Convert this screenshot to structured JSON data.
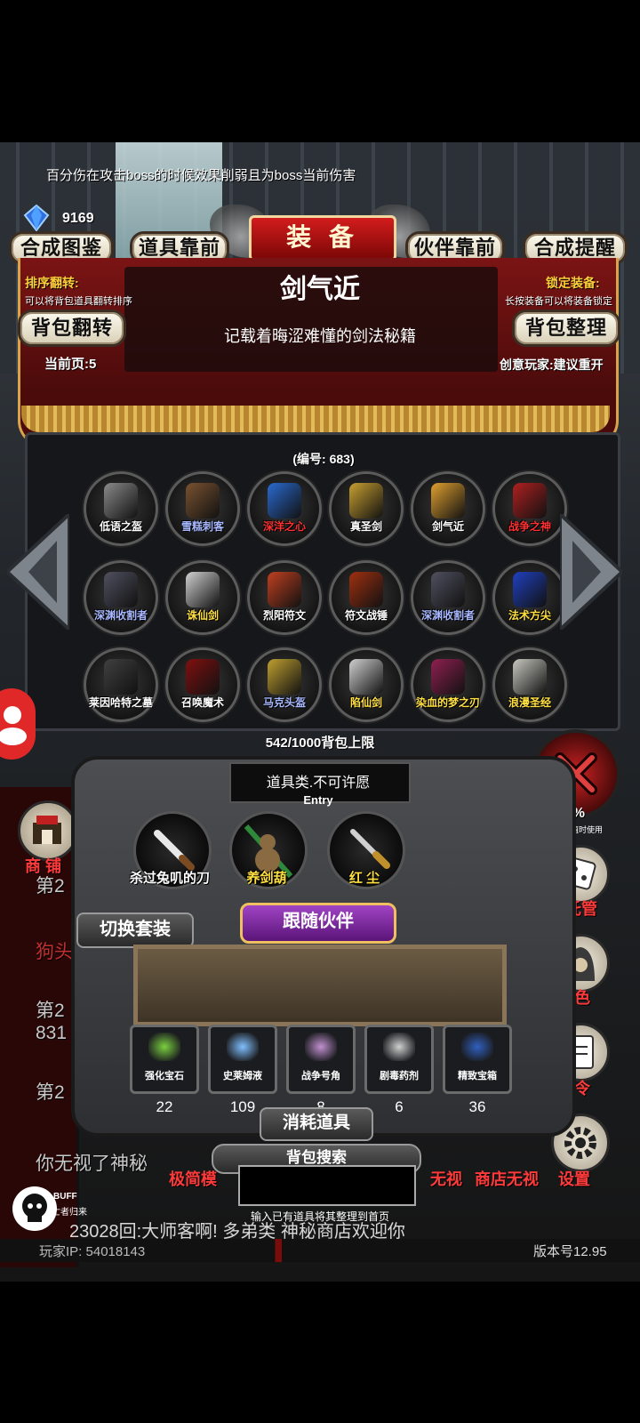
{
  "top_notice": "百分伤在攻击boss的时候效果削弱且为boss当前伤害",
  "gems": "9169",
  "header": {
    "btn_collection": "合成图鉴",
    "btn_items_front": "道具靠前",
    "title": "装 备",
    "btn_partner_front": "伙伴靠前",
    "btn_craft_remind": "合成提醒"
  },
  "sort": {
    "label": "排序翻转:",
    "note": "可以将背包道具翻转排序",
    "button": "背包翻转"
  },
  "lock": {
    "label": "锁定装备:",
    "note": "长按装备可以将装备锁定",
    "button": "背包整理"
  },
  "selected": {
    "name": "剑气近",
    "description": "记载着晦涩难懂的剑法秘籍",
    "page": "当前页:5",
    "creator": "创意玩家:建议重开",
    "id": "(编号: 683)"
  },
  "grid": [
    {
      "label": "低语之盔",
      "color": "#ffffff",
      "icon": "#8a8a8a"
    },
    {
      "label": "雪糕刺客",
      "color": "#a8b8ff",
      "icon": "#7a5230"
    },
    {
      "label": "深洋之心",
      "color": "#ff3030",
      "icon": "#2a6ad0"
    },
    {
      "label": "真圣剑",
      "color": "#ffffff",
      "icon": "#c9a030"
    },
    {
      "label": "剑气近",
      "color": "#ffffff",
      "icon": "#e0a030"
    },
    {
      "label": "战争之神",
      "color": "#ff3030",
      "icon": "#b02020"
    },
    {
      "label": "深渊收割者",
      "color": "#a8b8ff",
      "icon": "#505060"
    },
    {
      "label": "诛仙剑",
      "color": "#ffe040",
      "icon": "#d0d0d0"
    },
    {
      "label": "烈阳符文",
      "color": "#ffffff",
      "icon": "#c04020"
    },
    {
      "label": "符文战锤",
      "color": "#ffffff",
      "icon": "#a03010"
    },
    {
      "label": "深渊收割者",
      "color": "#a8b8ff",
      "icon": "#505060"
    },
    {
      "label": "法术方尖",
      "color": "#ffe040",
      "icon": "#2040c0"
    },
    {
      "label": "莱因哈特之墓",
      "color": "#ffffff",
      "icon": "#404040"
    },
    {
      "label": "召唤魔术",
      "color": "#ffffff",
      "icon": "#801010"
    },
    {
      "label": "马克头盔",
      "color": "#a8b8ff",
      "icon": "#c0a030"
    },
    {
      "label": "陷仙剑",
      "color": "#ffe040",
      "icon": "#d0d0d0"
    },
    {
      "label": "染血的梦之刃",
      "color": "#ffe040",
      "icon": "#902050"
    },
    {
      "label": "浪漫圣经",
      "color": "#ffe040",
      "icon": "#c8c8c0"
    }
  ],
  "capacity": "542/1000背包上限",
  "wish": {
    "text": "道具类.不可许愿",
    "sub": "Entry"
  },
  "equipped": [
    {
      "label": "杀过兔叽的刀",
      "color": "#ffffff"
    },
    {
      "label": "养剑葫",
      "color": "#ffe040"
    },
    {
      "label": "红 尘",
      "color": "#ffe040"
    }
  ],
  "switch_set": "切换套装",
  "follow_partner": "跟随伙伴",
  "consumables": [
    {
      "label": "强化宝石",
      "count": "22"
    },
    {
      "label": "史莱姆液",
      "count": "109"
    },
    {
      "label": "战争号角",
      "count": "8"
    },
    {
      "label": "剧毒药剂",
      "count": "6"
    },
    {
      "label": "精致宝箱",
      "count": "36"
    }
  ],
  "consumables_title": "消耗道具",
  "search": {
    "title": "背包搜索",
    "hint": "输入已有道具将其整理到首页"
  },
  "sidebar_left": {
    "shop": "商 铺"
  },
  "sidebar_right": {
    "pct": "56%",
    "pct_note": "其数值时使用",
    "manage": "托管",
    "role": "角色",
    "code": "口令",
    "settings": "设置"
  },
  "chat": [
    {
      "text": "第2"
    },
    {
      "text": "狗头"
    },
    {
      "text": "第2"
    },
    {
      "text": "831"
    },
    {
      "text": "第2"
    },
    {
      "text": "你无视了神秘"
    }
  ],
  "bottom": {
    "tab_left": "极简模",
    "tab_mid": "无视",
    "tab_right": "商店无视",
    "buff": "BUFF",
    "buff_note": "亡者归来",
    "ticker": "23028回:大师客啊!  多弟类   神秘商店欢迎你",
    "ip": "玩家IP: 54018143",
    "version": "版本号12.95"
  }
}
